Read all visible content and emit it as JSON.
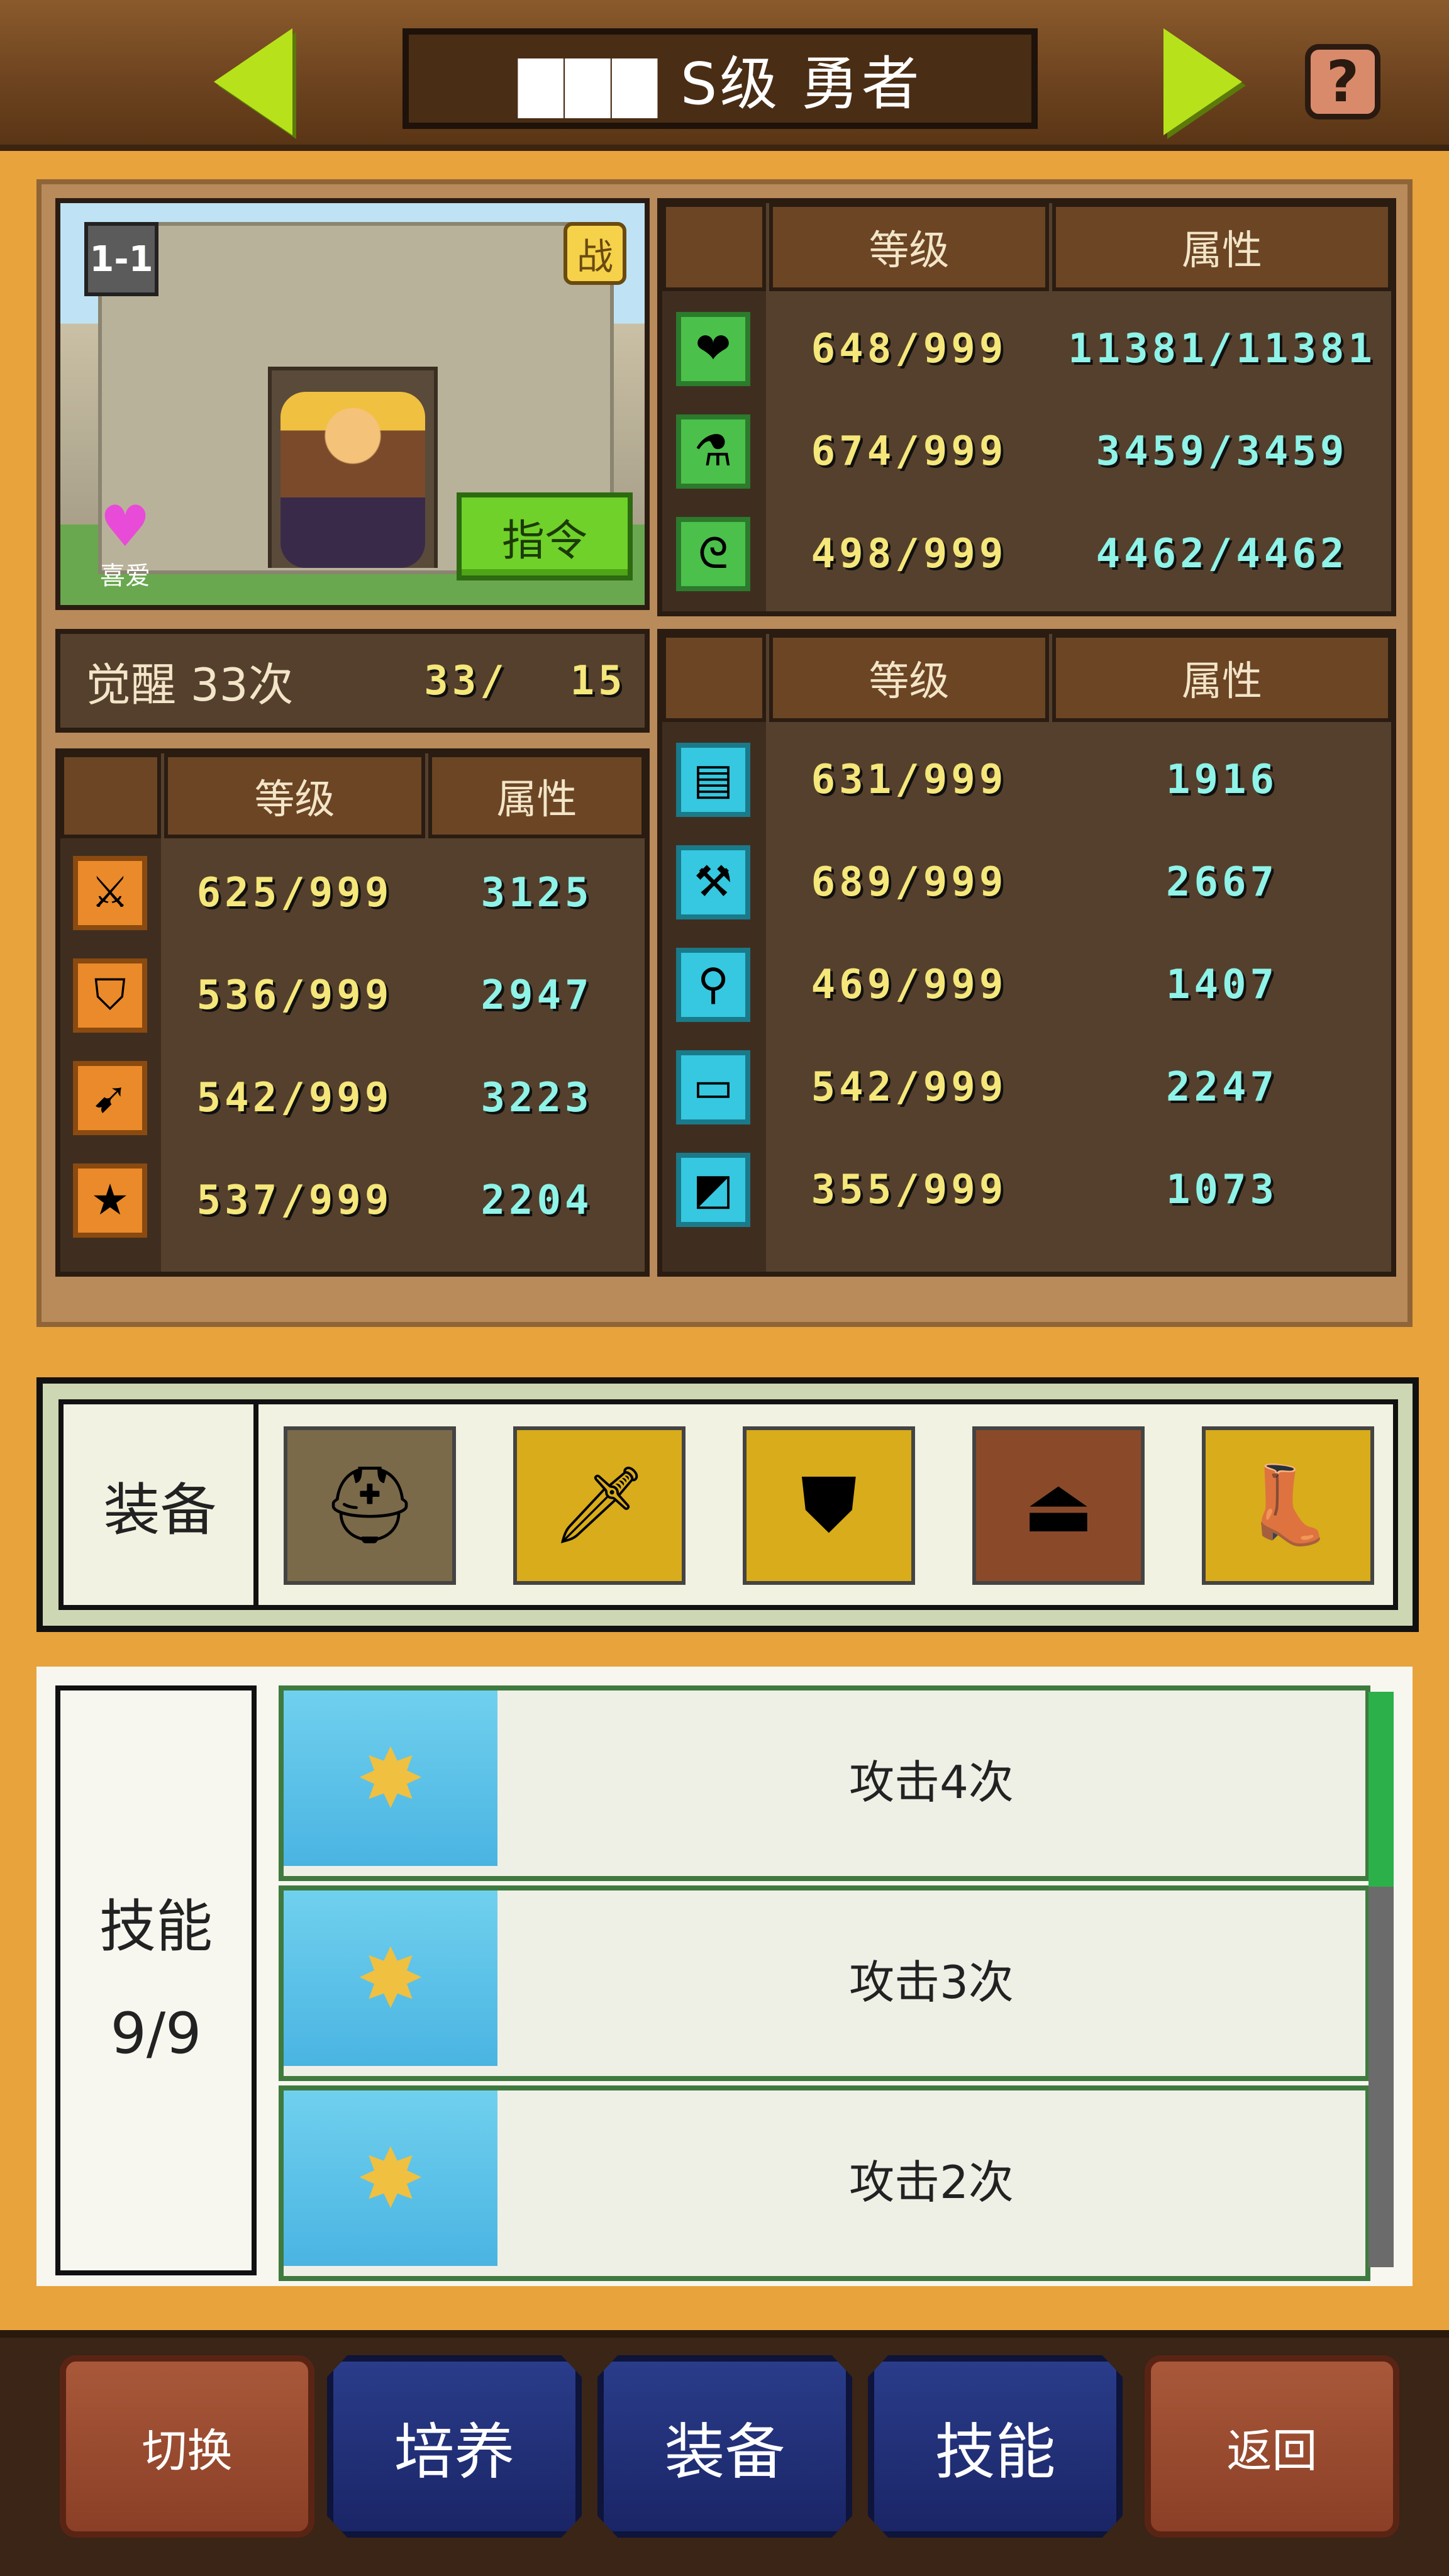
{
  "header": {
    "title": "▇▇▇ S级 勇者",
    "help_glyph": "?",
    "colors": {
      "arrow": "#b7e21b",
      "bar": "#6e4420"
    }
  },
  "portrait": {
    "tile_label": "1-1",
    "battle_badge": "战",
    "heart_label": "喜爱",
    "command_label": "指令"
  },
  "awaken": {
    "label": "觉醒 33次",
    "count": "33/",
    "max": "15"
  },
  "table_headers": {
    "level": "等级",
    "attribute": "属性"
  },
  "vitals": [
    {
      "icon": "heart-icon",
      "glyph": "❤",
      "level": "648/999",
      "value": "11381/11381"
    },
    {
      "icon": "potion-icon",
      "glyph": "⚗",
      "level": "674/999",
      "value": "3459/3459"
    },
    {
      "icon": "stamina-icon",
      "glyph": "ᘓ",
      "level": "498/999",
      "value": "4462/4462"
    }
  ],
  "combat": [
    {
      "icon": "sword-icon",
      "glyph": "⚔",
      "level": "625/999",
      "value": "3125"
    },
    {
      "icon": "shield-icon",
      "glyph": "⛉",
      "level": "536/999",
      "value": "2947"
    },
    {
      "icon": "bow-icon",
      "glyph": "➹",
      "level": "542/999",
      "value": "3223"
    },
    {
      "icon": "star-icon",
      "glyph": "★",
      "level": "537/999",
      "value": "2204"
    }
  ],
  "crafting": [
    {
      "icon": "book-icon",
      "glyph": "▤",
      "level": "631/999",
      "value": "1916"
    },
    {
      "icon": "hammer-icon",
      "glyph": "⚒",
      "level": "689/999",
      "value": "2667"
    },
    {
      "icon": "shovel-icon",
      "glyph": "⚲",
      "level": "469/999",
      "value": "1407"
    },
    {
      "icon": "chest-icon",
      "glyph": "▭",
      "level": "542/999",
      "value": "2247"
    },
    {
      "icon": "tool-icon",
      "glyph": "◩",
      "level": "355/999",
      "value": "1073"
    }
  ],
  "equipment": {
    "label": "装备",
    "slots": [
      {
        "icon": "helmet-icon",
        "glyph": "⛑",
        "bg": "#7a6a4a"
      },
      {
        "icon": "crystal-sword-icon",
        "glyph": "🗡",
        "bg": "#d8ac1a"
      },
      {
        "icon": "armor-icon",
        "glyph": "⛊",
        "bg": "#d8ac1a"
      },
      {
        "icon": "cloak-icon",
        "glyph": "⏏",
        "bg": "#8a4a2a"
      },
      {
        "icon": "boot-icon",
        "glyph": "👢",
        "bg": "#d8ac1a"
      }
    ]
  },
  "skills": {
    "label": "技能",
    "count": "9/9",
    "items": [
      {
        "icon": "attack-skill-icon",
        "glyph": "✸",
        "label": "攻击4次"
      },
      {
        "icon": "attack-skill-icon",
        "glyph": "✸",
        "label": "攻击3次"
      },
      {
        "icon": "attack-skill-icon",
        "glyph": "✸",
        "label": "攻击2次"
      }
    ]
  },
  "nav": {
    "switch": "切换",
    "train": "培养",
    "equip": "装备",
    "skill": "技能",
    "back": "返回"
  }
}
